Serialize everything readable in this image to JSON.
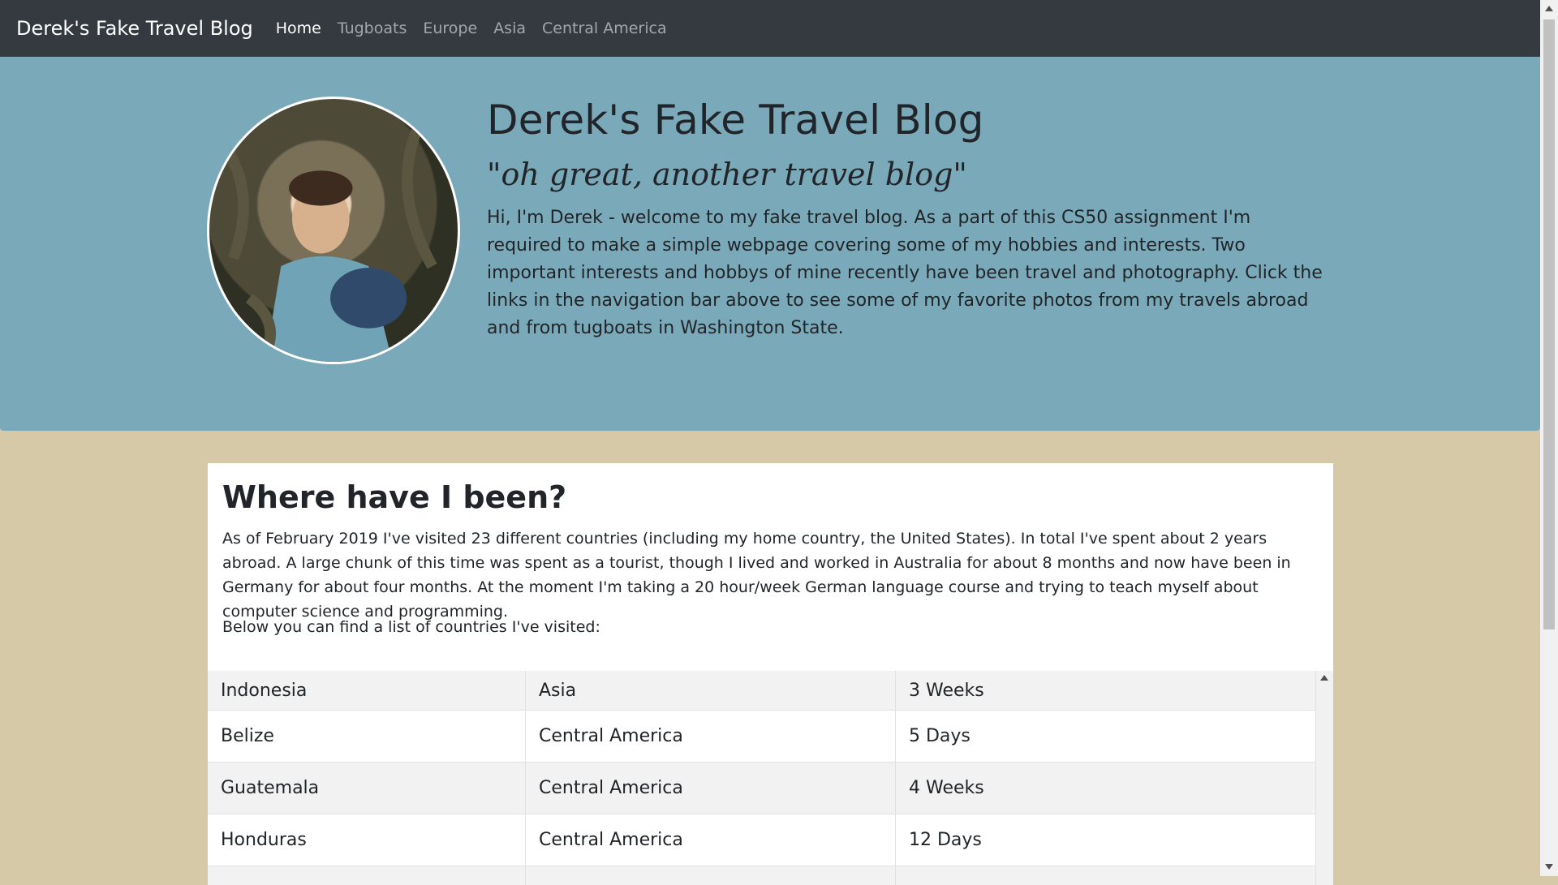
{
  "navbar": {
    "brand": "Derek's Fake Travel Blog",
    "links": [
      "Home",
      "Tugboats",
      "Europe",
      "Asia",
      "Central America"
    ],
    "active": "Home"
  },
  "hero": {
    "title": "Derek's Fake Travel Blog",
    "tagline": "\"oh great, another travel blog\"",
    "intro": "Hi, I'm Derek - welcome to my fake travel blog. As a part of this CS50 assignment I'm required to make a simple webpage covering some of my hobbies and interests. Two important interests and hobbys of mine recently have been travel and photography. Click the links in the navigation bar above to see some of my favorite photos from my travels abroad and from tugboats in Washington State."
  },
  "main": {
    "heading": "Where have I been?",
    "paragraph": "As of February 2019 I've visited 23 different countries (including my home country, the United States). In total I've spent about 2 years abroad. A large chunk of this time was spent as a tourist, though I lived and worked in Australia for about 8 months and now have been in Germany for about four months. At the moment I'm taking a 20 hour/week German language course and trying to teach myself about computer science and programming.",
    "list_intro": "Below you can find a list of countries I've visited:",
    "countries": [
      [
        "Indonesia",
        "Asia",
        "3 Weeks"
      ],
      [
        "Belize",
        "Central America",
        "5 Days"
      ],
      [
        "Guatemala",
        "Central America",
        "4 Weeks"
      ],
      [
        "Honduras",
        "Central America",
        "12 Days"
      ],
      [
        "",
        "",
        ""
      ]
    ]
  },
  "colors": {
    "navbar": "#343a40",
    "hero": "#7aaab9",
    "page_background": "#d6c9a8"
  }
}
